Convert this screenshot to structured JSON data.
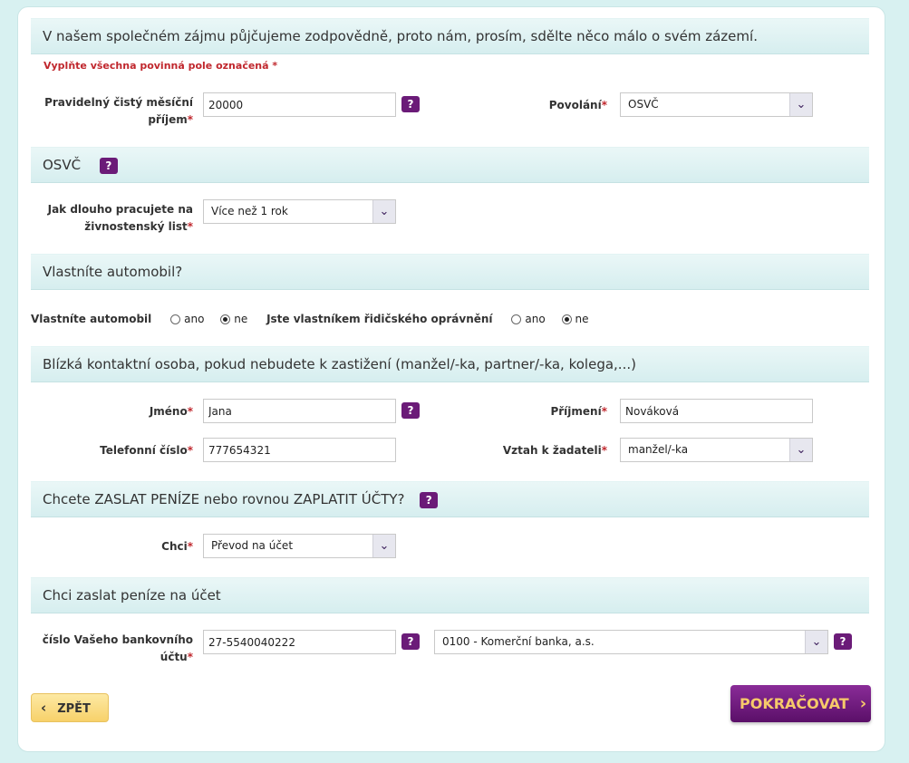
{
  "intro": {
    "title": "V našem společném zájmu půjčujeme zodpovědně, proto nám, prosím, sdělte něco málo o svém zázemí.",
    "required_note": "Vyplňte všechna povinná pole označená",
    "required_mark": "*"
  },
  "income": {
    "label_line1": "Pravidelný čistý měsíční",
    "label_line2": "příjem",
    "value": "20000"
  },
  "occupation": {
    "label": "Povolání",
    "value": "OSVČ"
  },
  "osvc_section": {
    "title": "OSVČ",
    "duration_label_line1": "Jak dlouho pracujete na",
    "duration_label_line2": "živnostenský list",
    "duration_value": "Více než 1 rok"
  },
  "car_section": {
    "title": "Vlastníte automobil?",
    "car_label": "Vlastníte automobil",
    "license_label": "Jste vlastníkem řidičského oprávnění",
    "yes": "ano",
    "no": "ne"
  },
  "contact_section": {
    "title": "Blízká kontaktní osoba, pokud nebudete k zastižení (manžel/-ka, partner/-ka, kolega,...)",
    "first_name_label": "Jméno",
    "first_name_value": "Jana",
    "last_name_label": "Příjmení",
    "last_name_value": "Nováková",
    "phone_label": "Telefonní číslo",
    "phone_value": "777654321",
    "relation_label": "Vztah k žadateli",
    "relation_value": "manžel/-ka"
  },
  "payment_section": {
    "title": "Chcete ZASLAT PENÍZE nebo rovnou ZAPLATIT ÚČTY?",
    "want_label": "Chci",
    "want_value": "Převod na účet"
  },
  "account_section": {
    "title": "Chci zaslat peníze na účet",
    "account_label_line1": "číslo Vašeho bankovního",
    "account_label_line2": "účtu",
    "account_value": "27-5540040222",
    "bank_value": "0100 - Komerční banka, a.s."
  },
  "buttons": {
    "back": "ZPĚT",
    "continue": "POKRAČOVAT"
  },
  "icons": {
    "help": "?",
    "chevron_down": "⌄",
    "chevron_left": "‹",
    "chevron_right": "›"
  },
  "colors": {
    "accent_purple": "#6b1b78",
    "required_red": "#c0272d",
    "back_button_yellow": "#f7d16a",
    "continue_text_gold": "#f6c96a"
  }
}
